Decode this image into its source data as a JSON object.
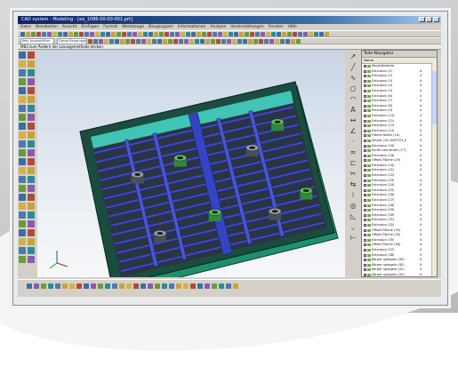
{
  "window": {
    "title": "CAD system - Modeling - [ea_1086-00-00-001.prt]"
  },
  "menu": [
    "Datei",
    "Bearbeiten",
    "Ansicht",
    "Einfügen",
    "Format",
    "Werkzeuge",
    "Baugruppen",
    "Informationen",
    "Analyse",
    "Voreinstellungen",
    "Fenster",
    "Hilfe"
  ],
  "toolbar": {
    "filter_value": "Kein Auswahlfilter",
    "snap_value": "Ganze Baugruppe"
  },
  "cue_line": "MB3 zum Ändern der Lösungsmethode klicken",
  "navigator": {
    "title": "Teile-Navigator",
    "columns": [
      "Name",
      "",
      ""
    ],
    "rows": [
      {
        "name": "Modellhistorie",
        "c2": "",
        "c3": ""
      },
      {
        "name": "Extrusion (1)",
        "c2": "4",
        "c3": ""
      },
      {
        "name": "Extrusion (2)",
        "c2": "4",
        "c3": ""
      },
      {
        "name": "Extrusion (3)",
        "c2": "4",
        "c3": ""
      },
      {
        "name": "Extrusion (4)",
        "c2": "4",
        "c3": ""
      },
      {
        "name": "Extrusion (5)",
        "c2": "4",
        "c3": ""
      },
      {
        "name": "Extrusion (6)",
        "c2": "4",
        "c3": ""
      },
      {
        "name": "Extrusion (7)",
        "c2": "4",
        "c3": ""
      },
      {
        "name": "Extrusion (8)",
        "c2": "4",
        "c3": ""
      },
      {
        "name": "Extrusion (9)",
        "c2": "4",
        "c3": ""
      },
      {
        "name": "Extrusion (10)",
        "c2": "4",
        "c3": ""
      },
      {
        "name": "Extrusion (11)",
        "c2": "4",
        "c3": ""
      },
      {
        "name": "Extrusion (12)",
        "c2": "4",
        "c3": ""
      },
      {
        "name": "Extrusion (13)",
        "c2": "4",
        "c3": ""
      },
      {
        "name": "Fläche teilen (14)",
        "c2": "4",
        "c3": ""
      },
      {
        "name": "Skizze (15) SKETCH_0",
        "c2": "4",
        "c3": ""
      },
      {
        "name": "Extrusion (16)",
        "c2": "4",
        "c3": ""
      },
      {
        "name": "Kante verrunden (17)",
        "c2": "4",
        "c3": ""
      },
      {
        "name": "Extrusion (18)",
        "c2": "4",
        "c3": ""
      },
      {
        "name": "Offset-Fläche (19)",
        "c2": "4",
        "c3": ""
      },
      {
        "name": "Extrusion (20)",
        "c2": "4",
        "c3": ""
      },
      {
        "name": "Extrusion (21)",
        "c2": "4",
        "c3": ""
      },
      {
        "name": "Extrusion (22)",
        "c2": "4",
        "c3": ""
      },
      {
        "name": "Extrusion (23)",
        "c2": "4",
        "c3": ""
      },
      {
        "name": "Extrusion (24)",
        "c2": "4",
        "c3": ""
      },
      {
        "name": "Extrusion (25)",
        "c2": "4",
        "c3": ""
      },
      {
        "name": "Extrusion (26)",
        "c2": "4",
        "c3": ""
      },
      {
        "name": "Extrusion (27)",
        "c2": "4",
        "c3": ""
      },
      {
        "name": "Extrusion (28)",
        "c2": "4",
        "c3": ""
      },
      {
        "name": "Extrusion (29)",
        "c2": "4",
        "c3": ""
      },
      {
        "name": "Extrusion (30)",
        "c2": "4",
        "c3": ""
      },
      {
        "name": "Extrusion (31)",
        "c2": "4",
        "c3": ""
      },
      {
        "name": "Extrusion (32)",
        "c2": "4",
        "c3": ""
      },
      {
        "name": "Offset-Fläche (33)",
        "c2": "4",
        "c3": ""
      },
      {
        "name": "Offset-Fläche (34)",
        "c2": "4",
        "c3": ""
      },
      {
        "name": "Extrusion (35)",
        "c2": "4",
        "c3": ""
      },
      {
        "name": "Offset-Fläche (36)",
        "c2": "4",
        "c3": ""
      },
      {
        "name": "Extrusion (37)",
        "c2": "4",
        "c3": ""
      },
      {
        "name": "Extrusion (38)",
        "c2": "4",
        "c3": ""
      },
      {
        "name": "Körper spiegeln (39)",
        "c2": "4",
        "c3": ""
      },
      {
        "name": "Körper spiegeln (40)",
        "c2": "4",
        "c3": ""
      },
      {
        "name": "Körper spiegeln (41)",
        "c2": "4",
        "c3": ""
      },
      {
        "name": "Körper spiegeln (42)",
        "c2": "4",
        "c3": ""
      }
    ]
  },
  "colors": {
    "titlebar": "#0a246a",
    "tray_blue": "#2a3fb0",
    "tray_green": "#1f8f6e",
    "tray_dark": "#2c3440",
    "viewport_top": "#c9d4e6"
  }
}
